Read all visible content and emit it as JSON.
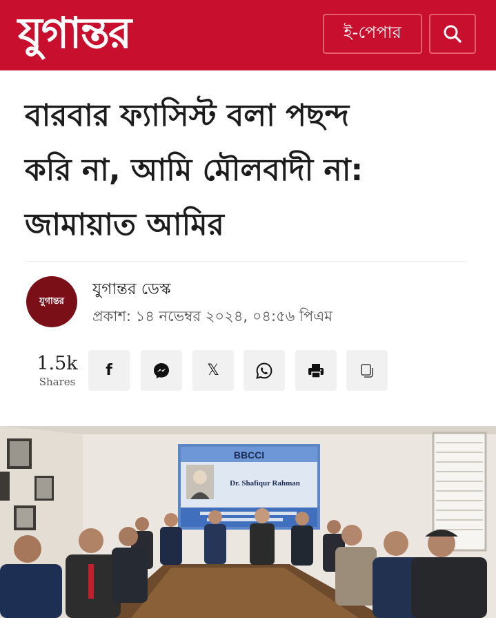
{
  "header": {
    "logo_text": "যুগান্তর",
    "epaper_label": "ই-পেপার",
    "search_icon": "search-icon",
    "brand_color": "#c8102e"
  },
  "article": {
    "headline_lines": [
      "বারবার ফ্যাসিস্ট বলা পছন্দ",
      "করি না, আমি মৌলবাদী না:",
      "জামায়াত আমির"
    ],
    "author": {
      "avatar_text": "যুগান্তর",
      "name": "যুগান্তর ডেস্ক",
      "published": "প্রকাশ: ১৪ নভেম্বর ২০২৪, ০৪:৫৬ পিএম"
    }
  },
  "share": {
    "count": "1.5k",
    "count_label": "Shares",
    "buttons": [
      {
        "icon": "facebook-icon",
        "glyph": "f"
      },
      {
        "icon": "messenger-icon"
      },
      {
        "icon": "x-icon",
        "glyph": "𝕏"
      },
      {
        "icon": "whatsapp-icon"
      },
      {
        "icon": "print-icon"
      },
      {
        "icon": "copy-icon"
      }
    ]
  },
  "photo": {
    "banner_title": "BBCCI",
    "banner_name": "Dr. Shafiqur Rahman"
  }
}
